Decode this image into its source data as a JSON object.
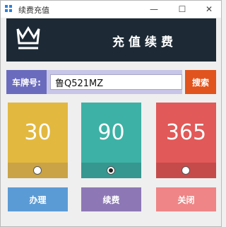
{
  "window": {
    "title": "续费充值",
    "controls": {
      "minimize": "—",
      "maximize": "☐",
      "close": "✕"
    }
  },
  "banner": {
    "icon": "crown-icon",
    "title": "充值续费"
  },
  "search": {
    "label": "车牌号:",
    "value": "鲁Q521MZ",
    "button": "搜索"
  },
  "plans": [
    {
      "value": "30",
      "selected": false,
      "color": "#e2b83f"
    },
    {
      "value": "90",
      "selected": true,
      "color": "#3db1a5"
    },
    {
      "value": "365",
      "selected": false,
      "color": "#e15958"
    }
  ],
  "actions": {
    "handle": "办理",
    "renew": "续费",
    "close": "关闭"
  },
  "colors": {
    "banner_bg": "#1d2a36",
    "label_bg": "#6a6bbd",
    "search_btn": "#e1541d",
    "handle_btn": "#5b9bd5",
    "renew_btn": "#8d78b5",
    "close_btn": "#ef8586"
  }
}
